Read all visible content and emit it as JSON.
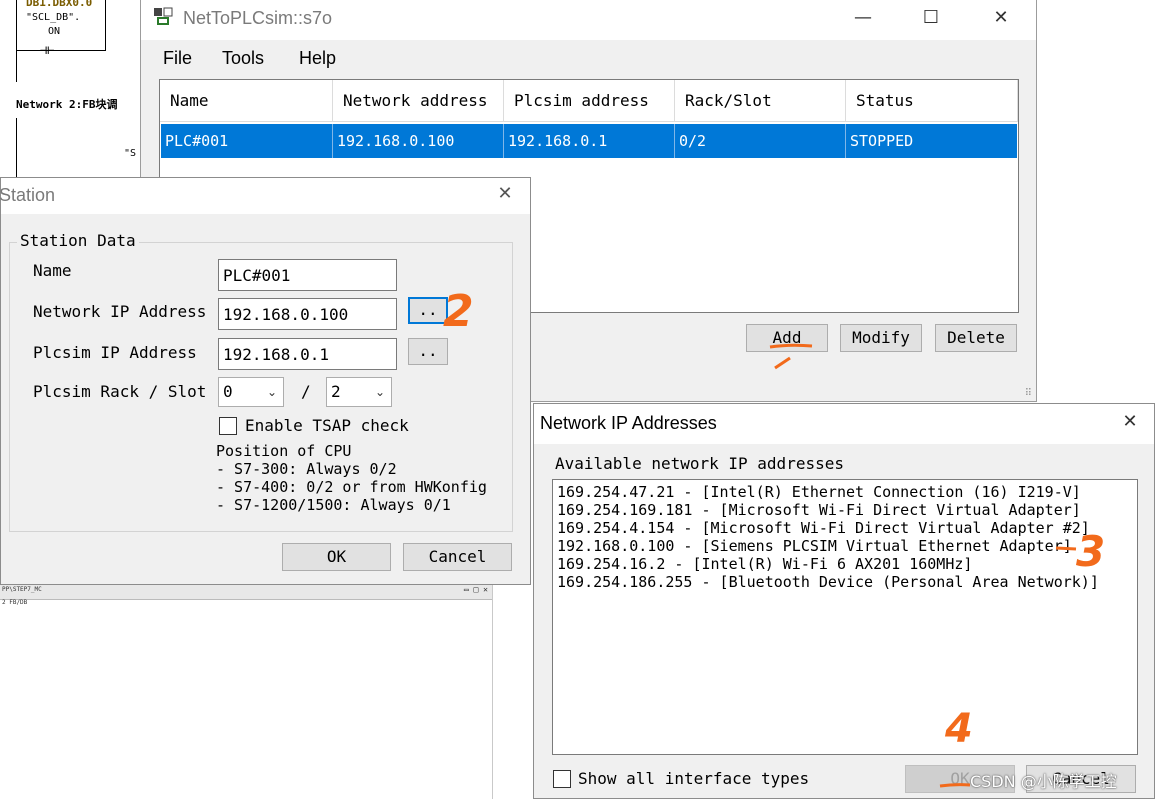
{
  "background": {
    "ladder_tag": "DB1.DBX0.0",
    "ladder_symbol": "\"SCL_DB\".",
    "ladder_value": "ON",
    "network_label": "Network 2:FB块调",
    "block_symbol": "\"S",
    "strip_path": "PP\\STEP7_MC",
    "strip_sub": "2 FB/DB"
  },
  "main_window": {
    "title": "NetToPLCsim::s7o",
    "menu": [
      "File",
      "Tools",
      "Help"
    ],
    "columns": [
      "Name",
      "Network address",
      "Plcsim address",
      "Rack/Slot",
      "Status"
    ],
    "rows": [
      [
        "PLC#001",
        "192.168.0.100",
        "192.168.0.1",
        "0/2",
        "STOPPED"
      ]
    ],
    "buttons": {
      "add": "Add",
      "modify": "Modify",
      "delete": "Delete"
    }
  },
  "station_dialog": {
    "title": "Station",
    "group_label": "Station Data",
    "name_label": "Name",
    "name_value": "PLC#001",
    "network_ip_label": "Network IP Address",
    "network_ip_value": "192.168.0.100",
    "plcsim_ip_label": "Plcsim IP Address",
    "plcsim_ip_value": "192.168.0.1",
    "browse_label": "..",
    "rack_slot_label": "Plcsim Rack / Slot",
    "rack_value": "0",
    "slash": "/",
    "slot_value": "2",
    "tsap_label": "Enable TSAP check",
    "cpu_position_title": "Position of CPU",
    "cpu_position_lines": [
      "- S7-300: Always 0/2",
      "- S7-400: 0/2 or from HWKonfig",
      "- S7-1200/1500: Always 0/1"
    ],
    "ok_label": "OK",
    "cancel_label": "Cancel"
  },
  "network_dialog": {
    "title": "Network IP Addresses",
    "list_label": "Available network IP addresses",
    "addresses": [
      "169.254.47.21 - [Intel(R) Ethernet Connection (16) I219-V]",
      "169.254.169.181 - [Microsoft Wi-Fi Direct Virtual Adapter]",
      "169.254.4.154 - [Microsoft Wi-Fi Direct Virtual Adapter #2]",
      "192.168.0.100 - [Siemens PLCSIM Virtual Ethernet Adapter]",
      "169.254.16.2 - [Intel(R) Wi-Fi 6 AX201 160MHz]",
      "169.254.186.255 - [Bluetooth Device (Personal Area Network)]"
    ],
    "show_all_label": "Show all interface types",
    "ok_label": "OK",
    "cancel_label": "Cancel"
  },
  "annotations": [
    "2",
    "3",
    "4"
  ],
  "watermark": "CSDN @小陈学工控",
  "colors": {
    "selection": "#0078d7",
    "annotation": "#f26a1b",
    "focus": "#0078d7"
  }
}
